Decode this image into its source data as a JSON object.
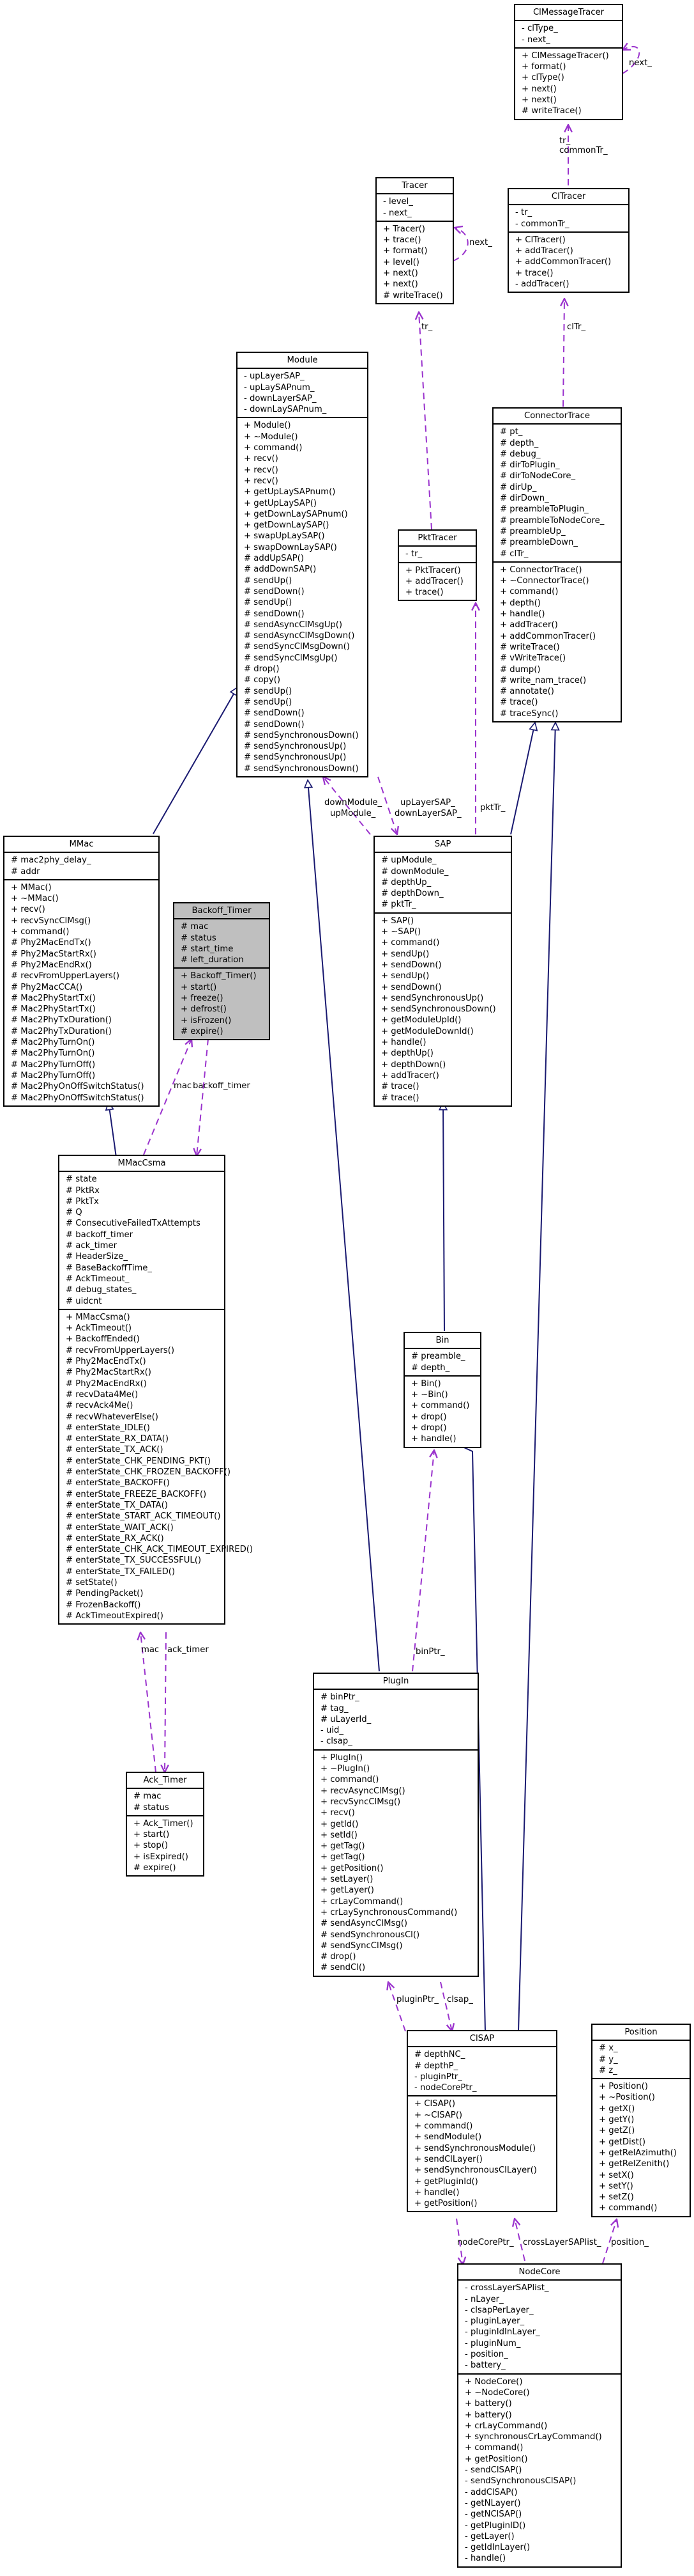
{
  "diagram": {
    "type": "UML class collaboration diagram",
    "colors": {
      "inheritance": "#191970",
      "usage": "#9a32cd",
      "highlight": "#bfbfbf"
    },
    "classes": {
      "clmessagetracer": {
        "name": "ClMessageTracer",
        "attributes": [
          "- clType_",
          "- next_"
        ],
        "operations": [
          "+ ClMessageTracer()",
          "+ format()",
          "+ clType()",
          "+ next()",
          "+ next()",
          "# writeTrace()"
        ]
      },
      "tracer": {
        "name": "Tracer",
        "attributes": [
          "- level_",
          "- next_"
        ],
        "operations": [
          "+ Tracer()",
          "+ trace()",
          "+ format()",
          "+ level()",
          "+ next()",
          "+ next()",
          "# writeTrace()"
        ]
      },
      "cltracer": {
        "name": "ClTracer",
        "attributes": [
          "- tr_",
          "- commonTr_"
        ],
        "operations": [
          "+ ClTracer()",
          "+ addTracer()",
          "+ addCommonTracer()",
          "+ trace()",
          "- addTracer()"
        ]
      },
      "module": {
        "name": "Module",
        "attributes": [
          "- upLayerSAP_",
          "- upLaySAPnum_",
          "- downLayerSAP_",
          "- downLaySAPnum_"
        ],
        "operations": [
          "+ Module()",
          "+ ~Module()",
          "+ command()",
          "+ recv()",
          "+ recv()",
          "+ recv()",
          "+ getUpLaySAPnum()",
          "+ getUpLaySAP()",
          "+ getDownLaySAPnum()",
          "+ getDownLaySAP()",
          "+ swapUpLaySAP()",
          "+ swapDownLaySAP()",
          "# addUpSAP()",
          "# addDownSAP()",
          "# sendUp()",
          "# sendDown()",
          "# sendUp()",
          "# sendDown()",
          "# sendAsyncClMsgUp()",
          "# sendAsyncClMsgDown()",
          "# sendSyncClMsgDown()",
          "# sendSyncClMsgUp()",
          "# drop()",
          "# copy()",
          "# sendUp()",
          "# sendUp()",
          "# sendDown()",
          "# sendDown()",
          "# sendSynchronousDown()",
          "# sendSynchronousUp()",
          "# sendSynchronousUp()",
          "# sendSynchronousDown()"
        ]
      },
      "connectortrace": {
        "name": "ConnectorTrace",
        "attributes": [
          "# pt_",
          "# depth_",
          "# debug_",
          "# dirToPlugin_",
          "# dirToNodeCore_",
          "# dirUp_",
          "# dirDown_",
          "# preambleToPlugin_",
          "# preambleToNodeCore_",
          "# preambleUp_",
          "# preambleDown_",
          "# clTr_"
        ],
        "operations": [
          "+ ConnectorTrace()",
          "+ ~ConnectorTrace()",
          "+ command()",
          "+ depth()",
          "+ handle()",
          "+ addTracer()",
          "+ addCommonTracer()",
          "# writeTrace()",
          "# vWriteTrace()",
          "# dump()",
          "# write_nam_trace()",
          "# annotate()",
          "# trace()",
          "# traceSync()"
        ]
      },
      "pkttracer": {
        "name": "PktTracer",
        "attributes": [
          "- tr_"
        ],
        "operations": [
          "+ PktTracer()",
          "+ addTracer()",
          "+ trace()"
        ]
      },
      "mmac": {
        "name": "MMac",
        "attributes": [
          "# mac2phy_delay_",
          "# addr"
        ],
        "operations": [
          "+ MMac()",
          "+ ~MMac()",
          "+ recv()",
          "+ recvSyncClMsg()",
          "+ command()",
          "# Phy2MacEndTx()",
          "# Phy2MacStartRx()",
          "# Phy2MacEndRx()",
          "# recvFromUpperLayers()",
          "# Phy2MacCCA()",
          "# Mac2PhyStartTx()",
          "# Mac2PhyStartTx()",
          "# Mac2PhyTxDuration()",
          "# Mac2PhyTxDuration()",
          "# Mac2PhyTurnOn()",
          "# Mac2PhyTurnOn()",
          "# Mac2PhyTurnOff()",
          "# Mac2PhyTurnOff()",
          "# Mac2PhyOnOffSwitchStatus()",
          "# Mac2PhyOnOffSwitchStatus()"
        ]
      },
      "backoff_timer": {
        "name": "Backoff_Timer",
        "attributes": [
          "# mac",
          "# status",
          "# start_time",
          "# left_duration"
        ],
        "operations": [
          "+ Backoff_Timer()",
          "+ start()",
          "+ freeze()",
          "+ defrost()",
          "+ isFrozen()",
          "# expire()"
        ]
      },
      "sap": {
        "name": "SAP",
        "attributes": [
          "# upModule_",
          "# downModule_",
          "# depthUp_",
          "# depthDown_",
          "# pktTr_"
        ],
        "operations": [
          "+ SAP()",
          "+ ~SAP()",
          "+ command()",
          "+ sendUp()",
          "+ sendDown()",
          "+ sendUp()",
          "+ sendDown()",
          "+ sendSynchronousUp()",
          "+ sendSynchronousDown()",
          "+ getModuleUpId()",
          "+ getModuleDownId()",
          "+ handle()",
          "+ depthUp()",
          "+ depthDown()",
          "+ addTracer()",
          "# trace()",
          "# trace()"
        ]
      },
      "mmaccsma": {
        "name": "MMacCsma",
        "attributes": [
          "# state",
          "# PktRx",
          "# PktTx",
          "# Q",
          "# ConsecutiveFailedTxAttempts",
          "# backoff_timer",
          "# ack_timer",
          "# HeaderSize_",
          "# BaseBackoffTime_",
          "# AckTimeout_",
          "# debug_states_",
          "# uidcnt"
        ],
        "operations": [
          "+ MMacCsma()",
          "+ AckTimeout()",
          "+ BackoffEnded()",
          "# recvFromUpperLayers()",
          "# Phy2MacEndTx()",
          "# Phy2MacStartRx()",
          "# Phy2MacEndRx()",
          "# recvData4Me()",
          "# recvAck4Me()",
          "# recvWhateverElse()",
          "# enterState_IDLE()",
          "# enterState_RX_DATA()",
          "# enterState_TX_ACK()",
          "# enterState_CHK_PENDING_PKT()",
          "# enterState_CHK_FROZEN_BACKOFF()",
          "# enterState_BACKOFF()",
          "# enterState_FREEZE_BACKOFF()",
          "# enterState_TX_DATA()",
          "# enterState_START_ACK_TIMEOUT()",
          "# enterState_WAIT_ACK()",
          "# enterState_RX_ACK()",
          "# enterState_CHK_ACK_TIMEOUT_EXPIRED()",
          "# enterState_TX_SUCCESSFUL()",
          "# enterState_TX_FAILED()",
          "# setState()",
          "# PendingPacket()",
          "# FrozenBackoff()",
          "# AckTimeoutExpired()"
        ]
      },
      "bin": {
        "name": "Bin",
        "attributes": [
          "# preamble_",
          "# depth_"
        ],
        "operations": [
          "+ Bin()",
          "+ ~Bin()",
          "+ command()",
          "+ drop()",
          "+ drop()",
          "+ handle()"
        ]
      },
      "ack_timer": {
        "name": "Ack_Timer",
        "attributes": [
          "# mac",
          "# status"
        ],
        "operations": [
          "+ Ack_Timer()",
          "+ start()",
          "+ stop()",
          "+ isExpired()",
          "# expire()"
        ]
      },
      "plugin": {
        "name": "PlugIn",
        "attributes": [
          "# binPtr_",
          "# tag_",
          "# uLayerId_",
          "- uid_",
          "- clsap_"
        ],
        "operations": [
          "+ PlugIn()",
          "+ ~PlugIn()",
          "+ command()",
          "+ recvAsyncClMsg()",
          "+ recvSyncClMsg()",
          "+ recv()",
          "+ getId()",
          "+ setId()",
          "+ getTag()",
          "+ getTag()",
          "+ getPosition()",
          "+ setLayer()",
          "+ getLayer()",
          "+ crLayCommand()",
          "+ crLaySynchronousCommand()",
          "# sendAsyncClMsg()",
          "# sendSynchronousCl()",
          "# sendSyncClMsg()",
          "# drop()",
          "# sendCl()"
        ]
      },
      "clsap": {
        "name": "ClSAP",
        "attributes": [
          "# depthNC_",
          "# depthP_",
          "- pluginPtr_",
          "- nodeCorePtr_"
        ],
        "operations": [
          "+ ClSAP()",
          "+ ~ClSAP()",
          "+ command()",
          "+ sendModule()",
          "+ sendSynchronousModule()",
          "+ sendClLayer()",
          "+ sendSynchronousClLayer()",
          "+ getPluginId()",
          "+ handle()",
          "+ getPosition()"
        ]
      },
      "position": {
        "name": "Position",
        "attributes": [
          "# x_",
          "# y_",
          "# z_"
        ],
        "operations": [
          "+ Position()",
          "+ ~Position()",
          "+ getX()",
          "+ getY()",
          "+ getZ()",
          "+ getDist()",
          "+ getRelAzimuth()",
          "+ getRelZenith()",
          "+ setX()",
          "+ setY()",
          "+ setZ()",
          "+ command()"
        ]
      },
      "nodecore": {
        "name": "NodeCore",
        "attributes": [
          "- crossLayerSAPlist_",
          "- nLayer_",
          "- clsapPerLayer_",
          "- pluginLayer_",
          "- pluginIdInLayer_",
          "- pluginNum_",
          "- position_",
          "- battery_"
        ],
        "operations": [
          "+ NodeCore()",
          "+ ~NodeCore()",
          "+ battery()",
          "+ battery()",
          "+ crLayCommand()",
          "+ synchronousCrLayCommand()",
          "+ command()",
          "+ getPosition()",
          "- sendClSAP()",
          "- sendSynchronousClSAP()",
          "- addClSAP()",
          "- getNLayer()",
          "- getNClSAP()",
          "- getPluginID()",
          "- getLayer()",
          "- getIdInLayer()",
          "- handle()"
        ]
      }
    },
    "edge_labels": {
      "clmsg_next": "next_",
      "clmsg_to_cltracer": "tr_\ncommonTr_",
      "tracer_next": "next_",
      "tracer_to_pkttracer": "tr_",
      "cltracer_to_connector": "clTr_",
      "module_sap_a": "downModule_",
      "module_sap_b": "upModule_",
      "sap_module_a": "upLayerSAP_",
      "sap_module_b": "downLayerSAP_",
      "pkttracer_sap": "pktTr_",
      "mac_backoff_a": "mac",
      "mac_backoff_b": "backoff_timer",
      "mac_ack_a": "mac",
      "mac_ack_b": "ack_timer",
      "bin_plugin": "binPtr_",
      "plugin_clsap_a": "pluginPtr_",
      "plugin_clsap_b": "clsap_",
      "nodecore_a": "nodeCorePtr_",
      "nodecore_b": "crossLayerSAPlist_",
      "nodecore_c": "position_"
    }
  }
}
